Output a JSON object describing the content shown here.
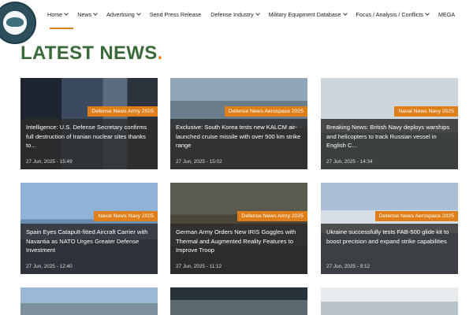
{
  "nav": {
    "items": [
      {
        "label": "Home",
        "dropdown": true
      },
      {
        "label": "News",
        "dropdown": true
      },
      {
        "label": "Advertising",
        "dropdown": true
      },
      {
        "label": "Send Press Release",
        "dropdown": false
      },
      {
        "label": "Defense Industry",
        "dropdown": true
      },
      {
        "label": "Military Equipment Database",
        "dropdown": true
      },
      {
        "label": "Focus / Analysis / Conflicts",
        "dropdown": true
      },
      {
        "label": "MEGA",
        "dropdown": false
      }
    ]
  },
  "page": {
    "title": "LATEST NEWS",
    "title_dot": "."
  },
  "colors": {
    "accent": "#e07f1a",
    "title_green": "#3a6a3a"
  },
  "cards": [
    {
      "category": "Defense News Army 2025",
      "title": "Intelligence: U.S. Defense Secretary confirms full destruction of Iranian nuclear sites thanks to...",
      "date": "27 Jun, 2025 - 15:49"
    },
    {
      "category": "Defense News Aerospace 2025",
      "title": "Exclusive: South Korea tests new KALCM air-launched cruise missile with over 500 km strike range",
      "date": "27 Jun, 2025 - 15:02"
    },
    {
      "category": "Naval News Navy 2025",
      "title": "Breaking News: British Navy deploys warships and helicopters to track Russian vessel in English C...",
      "date": "27 Jun, 2025 - 14:34"
    },
    {
      "category": "Naval News Navy 2025",
      "title": "Spain Eyes Catapult-fitted Aircraft Carrier with Navantia as NATO Urges Greater Defense Investment",
      "date": "27 Jun, 2025 - 12:40"
    },
    {
      "category": "Defense News Army 2025",
      "title": "German Army Orders New IRIS Goggles with Thermal and Augmented Reality Features to Improve Troop",
      "date": "27 Jun, 2025 - 11:12"
    },
    {
      "category": "Defense News Aerospace 2025",
      "title": "Ukraine successfully tests FAB-500 glide kit to boost precision and expand strike capabilities",
      "date": "27 Jun, 2025 - 9:12"
    }
  ]
}
